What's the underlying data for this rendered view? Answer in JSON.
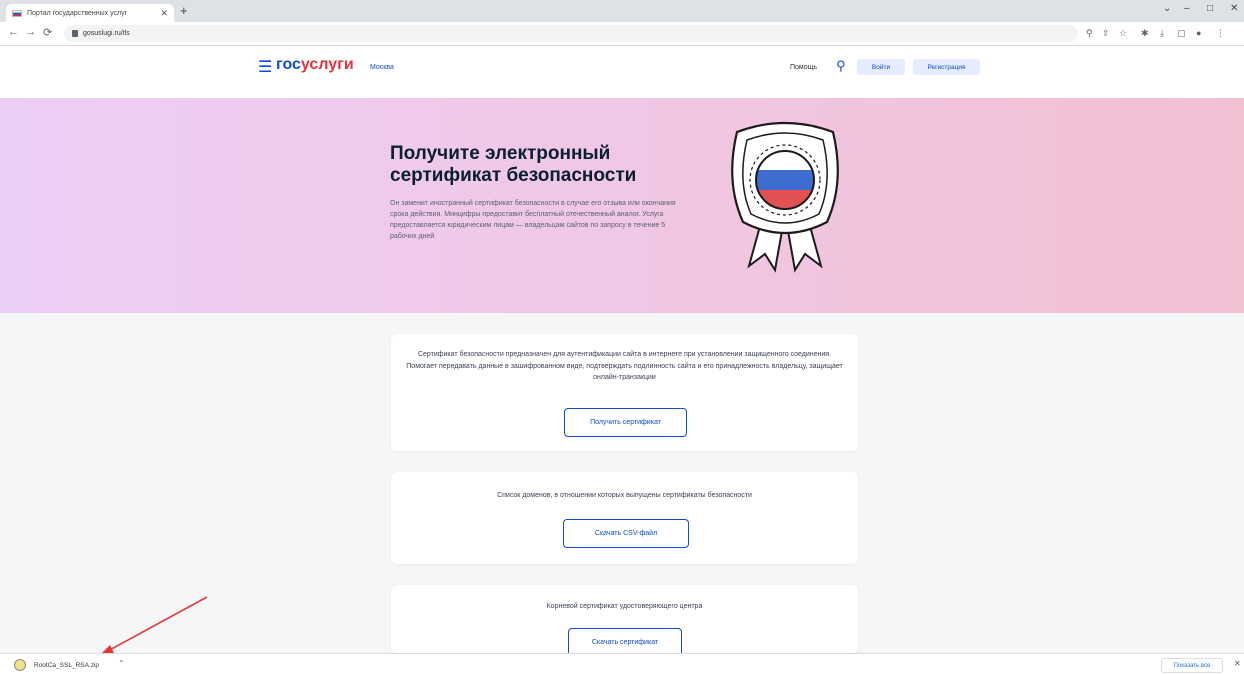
{
  "browser": {
    "tab_title": "Портал государственных услуг",
    "tab_close": "✕",
    "new_tab": "+",
    "url": "gosuslugi.ru/tls",
    "window_controls": [
      "⌄",
      "–",
      "□",
      "✕"
    ]
  },
  "header": {
    "logo_part1": "гос",
    "logo_part2": "услуги",
    "city": "Москва",
    "help": "Помощь",
    "login": "Войти",
    "register": "Регистрация"
  },
  "hero": {
    "title": "Получите электронный сертификат безопасности",
    "text": "Он заменит иностранный сертификат безопасности в случае его отзыва или окончания срока действия. Минцифры предоставит бесплатный отечественный аналог. Услуга предоставляется юридическим лицам — владельцам сайтов по запросу в течение 5 рабочих дней"
  },
  "cards": [
    {
      "text": "Сертификат безопасности предназначен для аутентификации сайта в интернете при установлении защищенного соединения. Помогает передавать данные в зашифрованном виде, подтверждать подлинность сайта и его принадлежность владельцу, защищает онлайн-транзакции",
      "button": "Получить сертификат"
    },
    {
      "text": "Список доменов, в отношении которых выпущены сертификаты безопасности",
      "button": "Скачать CSV-файл"
    },
    {
      "text": "Корневой сертификат удостоверяющего центра",
      "button": "Скачать сертификат"
    }
  ],
  "download_shelf": {
    "file": "RootCa_SSL_RSA.zip",
    "show_all": "Показать все"
  },
  "colors": {
    "brand_blue": "#0d4cd3",
    "brand_red": "#e5323f",
    "annotation_arrow": "#e53935"
  }
}
